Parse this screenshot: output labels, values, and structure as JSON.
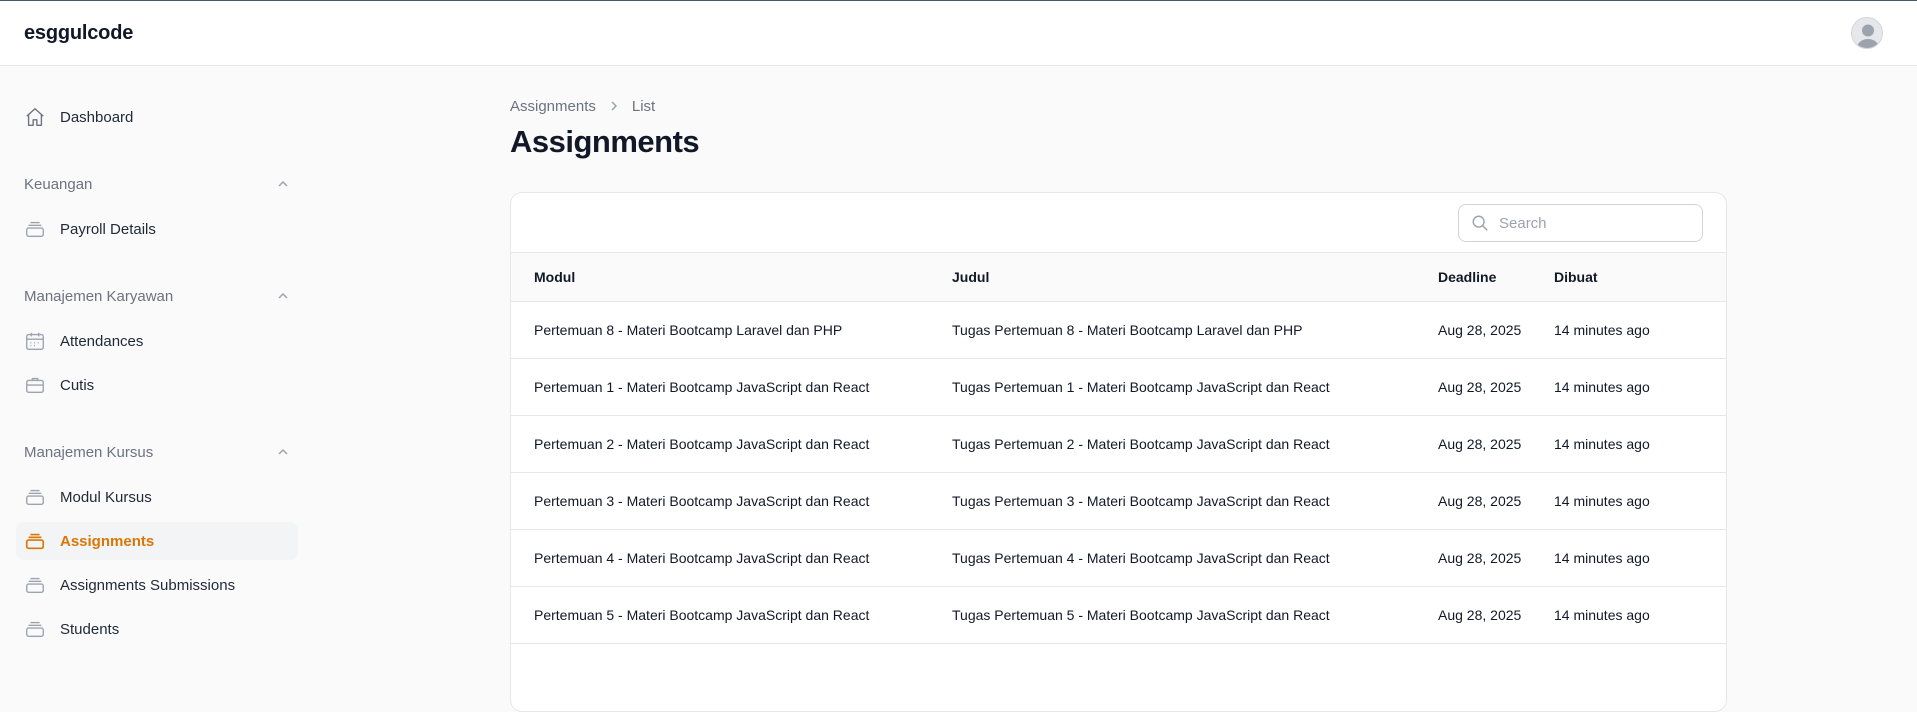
{
  "app": {
    "brand": "esggulcode"
  },
  "sidebar": {
    "dashboard": "Dashboard",
    "groups": [
      {
        "label": "Keuangan"
      },
      {
        "label": "Manajemen Karyawan"
      },
      {
        "label": "Manajemen Kursus"
      }
    ],
    "items": {
      "payroll": "Payroll Details",
      "attendances": "Attendances",
      "cutis": "Cutis",
      "modul": "Modul Kursus",
      "assignments": "Assignments",
      "submissions": "Assignments Submissions",
      "students": "Students"
    },
    "active": "Assignments",
    "accent_color": "#d97706"
  },
  "breadcrumb": {
    "parent": "Assignments",
    "current": "List"
  },
  "page": {
    "title": "Assignments"
  },
  "search": {
    "placeholder": "Search",
    "value": ""
  },
  "table": {
    "headers": [
      "Modul",
      "Judul",
      "Deadline",
      "Dibuat"
    ],
    "rows": [
      [
        "Pertemuan 8 - Materi Bootcamp Laravel dan PHP",
        "Tugas Pertemuan 8 - Materi Bootcamp Laravel dan PHP",
        "Aug 28, 2025",
        "14 minutes ago"
      ],
      [
        "Pertemuan 1 - Materi Bootcamp JavaScript dan React",
        "Tugas Pertemuan 1 - Materi Bootcamp JavaScript dan React",
        "Aug 28, 2025",
        "14 minutes ago"
      ],
      [
        "Pertemuan 2 - Materi Bootcamp JavaScript dan React",
        "Tugas Pertemuan 2 - Materi Bootcamp JavaScript dan React",
        "Aug 28, 2025",
        "14 minutes ago"
      ],
      [
        "Pertemuan 3 - Materi Bootcamp JavaScript dan React",
        "Tugas Pertemuan 3 - Materi Bootcamp JavaScript dan React",
        "Aug 28, 2025",
        "14 minutes ago"
      ],
      [
        "Pertemuan 4 - Materi Bootcamp JavaScript dan React",
        "Tugas Pertemuan 4 - Materi Bootcamp JavaScript dan React",
        "Aug 28, 2025",
        "14 minutes ago"
      ],
      [
        "Pertemuan 5 - Materi Bootcamp JavaScript dan React",
        "Tugas Pertemuan 5 - Materi Bootcamp JavaScript dan React",
        "Aug 28, 2025",
        "14 minutes ago"
      ]
    ]
  },
  "icons": {
    "dashboard": "home-icon",
    "payroll": "stack-icon",
    "attendances": "calendar-icon",
    "cutis": "briefcase-icon",
    "modul": "stack-icon",
    "assignments": "stack-icon",
    "submissions": "stack-icon",
    "students": "stack-icon",
    "group_toggle": "chevron-up-icon",
    "breadcrumb_separator": "chevron-right-icon",
    "search": "search-icon",
    "avatar": "user-avatar-icon"
  }
}
